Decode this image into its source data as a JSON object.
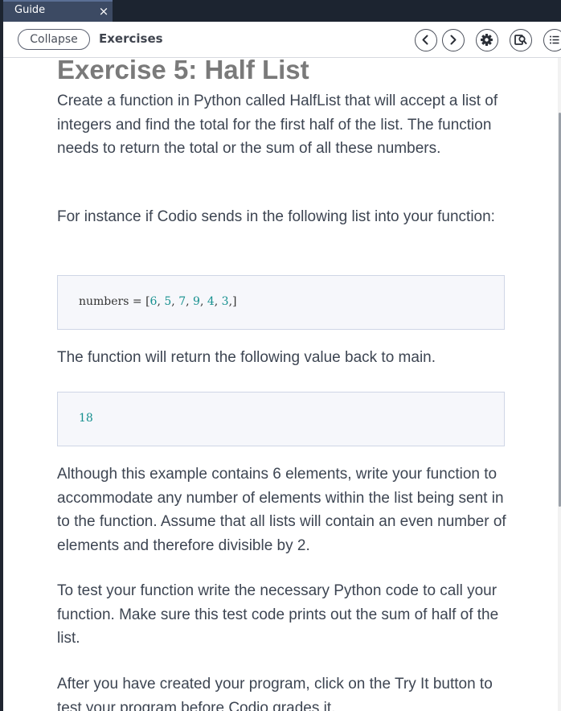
{
  "tab": {
    "title": "Guide",
    "close_glyph": "×"
  },
  "toolbar": {
    "collapse_label": "Collapse",
    "title": "Exercises",
    "icons": [
      "chevron-left-icon",
      "chevron-right-icon",
      "gear-icon",
      "search-icon",
      "list-icon"
    ]
  },
  "content": {
    "title": "Exercise 5: Half List",
    "paragraphs": [
      "Create a function in Python called HalfList that will accept a list of integers and find the total for the first half of the list. The function needs to return the total or the sum of all these numbers.",
      "For instance if Codio sends in the following list into your function:",
      "The function will return the following value back to main.",
      "Although this example contains 6 elements, write your function to accommodate any number of elements within the list being sent in to the function. Assume that all lists will contain an even number of elements and therefore divisible by 2.",
      "To test your function write the necessary Python code to call your function. Make sure this test code prints out the sum of half of the list.",
      "After you have created your program, click on the Try It button to test your program before Codio grades it."
    ],
    "code1": {
      "prefix": "numbers = [",
      "numbers": [
        "6",
        "5",
        "7",
        "9",
        "4",
        "3"
      ],
      "separator": ", ",
      "suffix": ",]"
    },
    "code2": {
      "value": "18"
    }
  },
  "colors": {
    "tab_bar": "#1c2430",
    "tab_active": "#3c4a63",
    "title_gray": "#7a7a7a",
    "body_text": "#3d4552",
    "code_number": "#16908f",
    "code_bg": "#f6f7fb"
  }
}
